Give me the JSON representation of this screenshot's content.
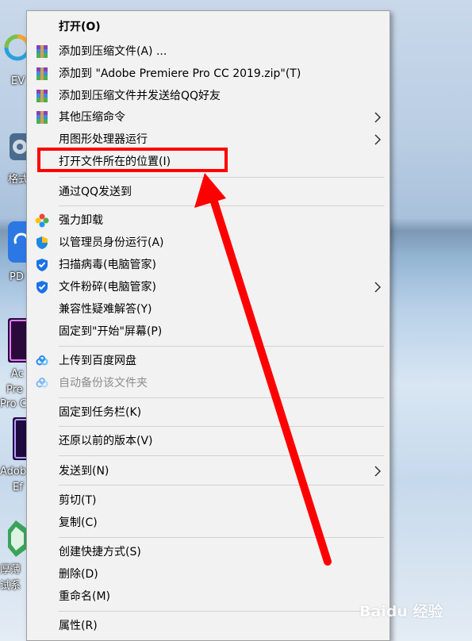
{
  "desktop": {
    "labels": [
      "EV",
      "格式",
      "PD",
      "Ac",
      "Pre",
      "Pro C",
      "Adob",
      "Ef",
      "厚薄",
      "试系"
    ]
  },
  "menu": {
    "items": [
      {
        "label": "打开(O)",
        "icon": "none"
      },
      {
        "label": "添加到压缩文件(A) ...",
        "icon": "winrar-icon"
      },
      {
        "label": "添加到 \"Adobe Premiere Pro CC 2019.zip\"(T)",
        "icon": "winrar-icon"
      },
      {
        "label": "添加到压缩文件并发送给QQ好友",
        "icon": "winrar-icon"
      },
      {
        "label": "其他压缩命令",
        "icon": "winrar-icon",
        "submenu": true
      },
      {
        "label": "用图形处理器运行",
        "icon": "none",
        "submenu": true
      },
      {
        "label": "打开文件所在的位置(I)",
        "icon": "none"
      },
      {
        "label": "通过QQ发送到",
        "icon": "none"
      },
      {
        "label": "强力卸载",
        "icon": "pinwheel-icon"
      },
      {
        "label": "以管理员身份运行(A)",
        "icon": "shield-icon"
      },
      {
        "label": "扫描病毒(电脑管家)",
        "icon": "tencent-guard-icon"
      },
      {
        "label": "文件粉碎(电脑管家)",
        "icon": "tencent-guard-icon",
        "submenu": true
      },
      {
        "label": "兼容性疑难解答(Y)",
        "icon": "none"
      },
      {
        "label": "固定到\"开始\"屏幕(P)",
        "icon": "none"
      },
      {
        "label": "上传到百度网盘",
        "icon": "baidu-cloud-icon"
      },
      {
        "label": "自动备份该文件夹",
        "icon": "baidu-cloud-icon",
        "disabled": true
      },
      {
        "label": "固定到任务栏(K)",
        "icon": "none"
      },
      {
        "label": "还原以前的版本(V)",
        "icon": "none"
      },
      {
        "label": "发送到(N)",
        "icon": "none",
        "submenu": true
      },
      {
        "label": "剪切(T)",
        "icon": "none"
      },
      {
        "label": "复制(C)",
        "icon": "none"
      },
      {
        "label": "创建快捷方式(S)",
        "icon": "none"
      },
      {
        "label": "删除(D)",
        "icon": "none"
      },
      {
        "label": "重命名(M)",
        "icon": "none"
      },
      {
        "label": "属性(R)",
        "icon": "none"
      }
    ]
  },
  "annotation": {
    "highlighted_item": "打开文件所在的位置(I)",
    "color": "#ff0000"
  },
  "watermark": {
    "text": "Baidu 经验"
  },
  "colors": {
    "menu_bg": "#f2f2f2",
    "separator": "#d2d2d2",
    "disabled_text": "#8d8d8d",
    "annotation_red": "#ff0000"
  }
}
